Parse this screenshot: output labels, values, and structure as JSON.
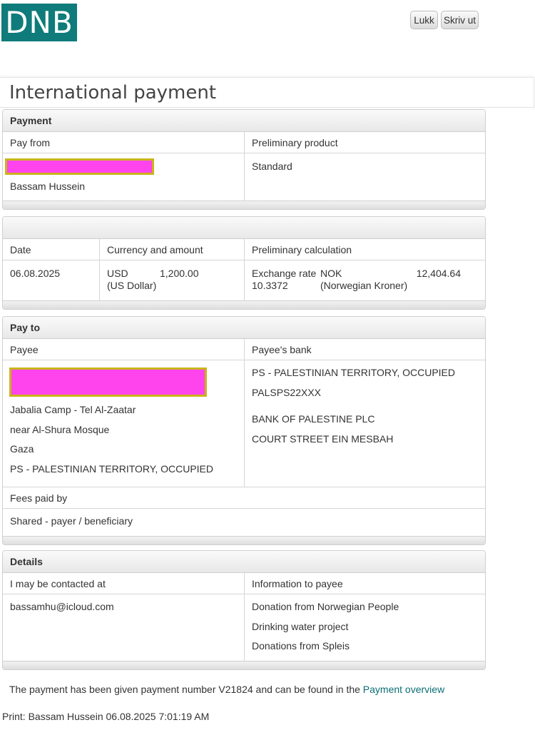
{
  "header": {
    "logo_text": "DNB",
    "close_label": "Lukk",
    "print_label": "Skriv ut"
  },
  "page_title": "International payment",
  "payment": {
    "title": "Payment",
    "pay_from_label": "Pay from",
    "pay_from_name": "Bassam Hussein",
    "product_label": "Preliminary product",
    "product_value": "Standard"
  },
  "amount": {
    "date_label": "Date",
    "date_value": "06.08.2025",
    "currency_label": "Currency and amount",
    "currency_code": "USD",
    "currency_amount": "1,200.00",
    "currency_name": "(US Dollar)",
    "calc_label": "Preliminary calculation",
    "rate_label": "Exchange rate",
    "rate_value": "10.3372",
    "target_currency": "NOK",
    "target_amount": "12,404.64",
    "target_name": "(Norwegian Kroner)"
  },
  "pay_to": {
    "title": "Pay to",
    "payee_label": "Payee",
    "payee_lines": [
      "Jabalia Camp - Tel Al-Zaatar",
      "near Al-Shura Mosque",
      "Gaza",
      "PS - PALESTINIAN TERRITORY, OCCUPIED"
    ],
    "bank_label": "Payee's bank",
    "bank_lines": [
      "PS - PALESTINIAN TERRITORY, OCCUPIED",
      "PALSPS22XXX",
      "BANK OF PALESTINE PLC",
      "COURT STREET EIN MESBAH"
    ],
    "fees_label": "Fees paid by",
    "fees_value": "Shared - payer / beneficiary"
  },
  "details": {
    "title": "Details",
    "contact_label": "I may be contacted at",
    "contact_value": "bassamhu@icloud.com",
    "info_label": "Information to payee",
    "info_lines": [
      "Donation from Norwegian People",
      "Drinking water project",
      "Donations from Spleis"
    ]
  },
  "footer": {
    "message_prefix": "The payment has been given payment number V21824 and can be found in the",
    "overview_link": "Payment overview",
    "print_line": "Print:  Bassam  Hussein  06.08.2025 7:01:19 AM"
  },
  "colors": {
    "brand": "#0f7b7b",
    "link": "#0a6e74",
    "redaction_fill": "#ff44ee",
    "redaction_border": "#c9b41a"
  }
}
